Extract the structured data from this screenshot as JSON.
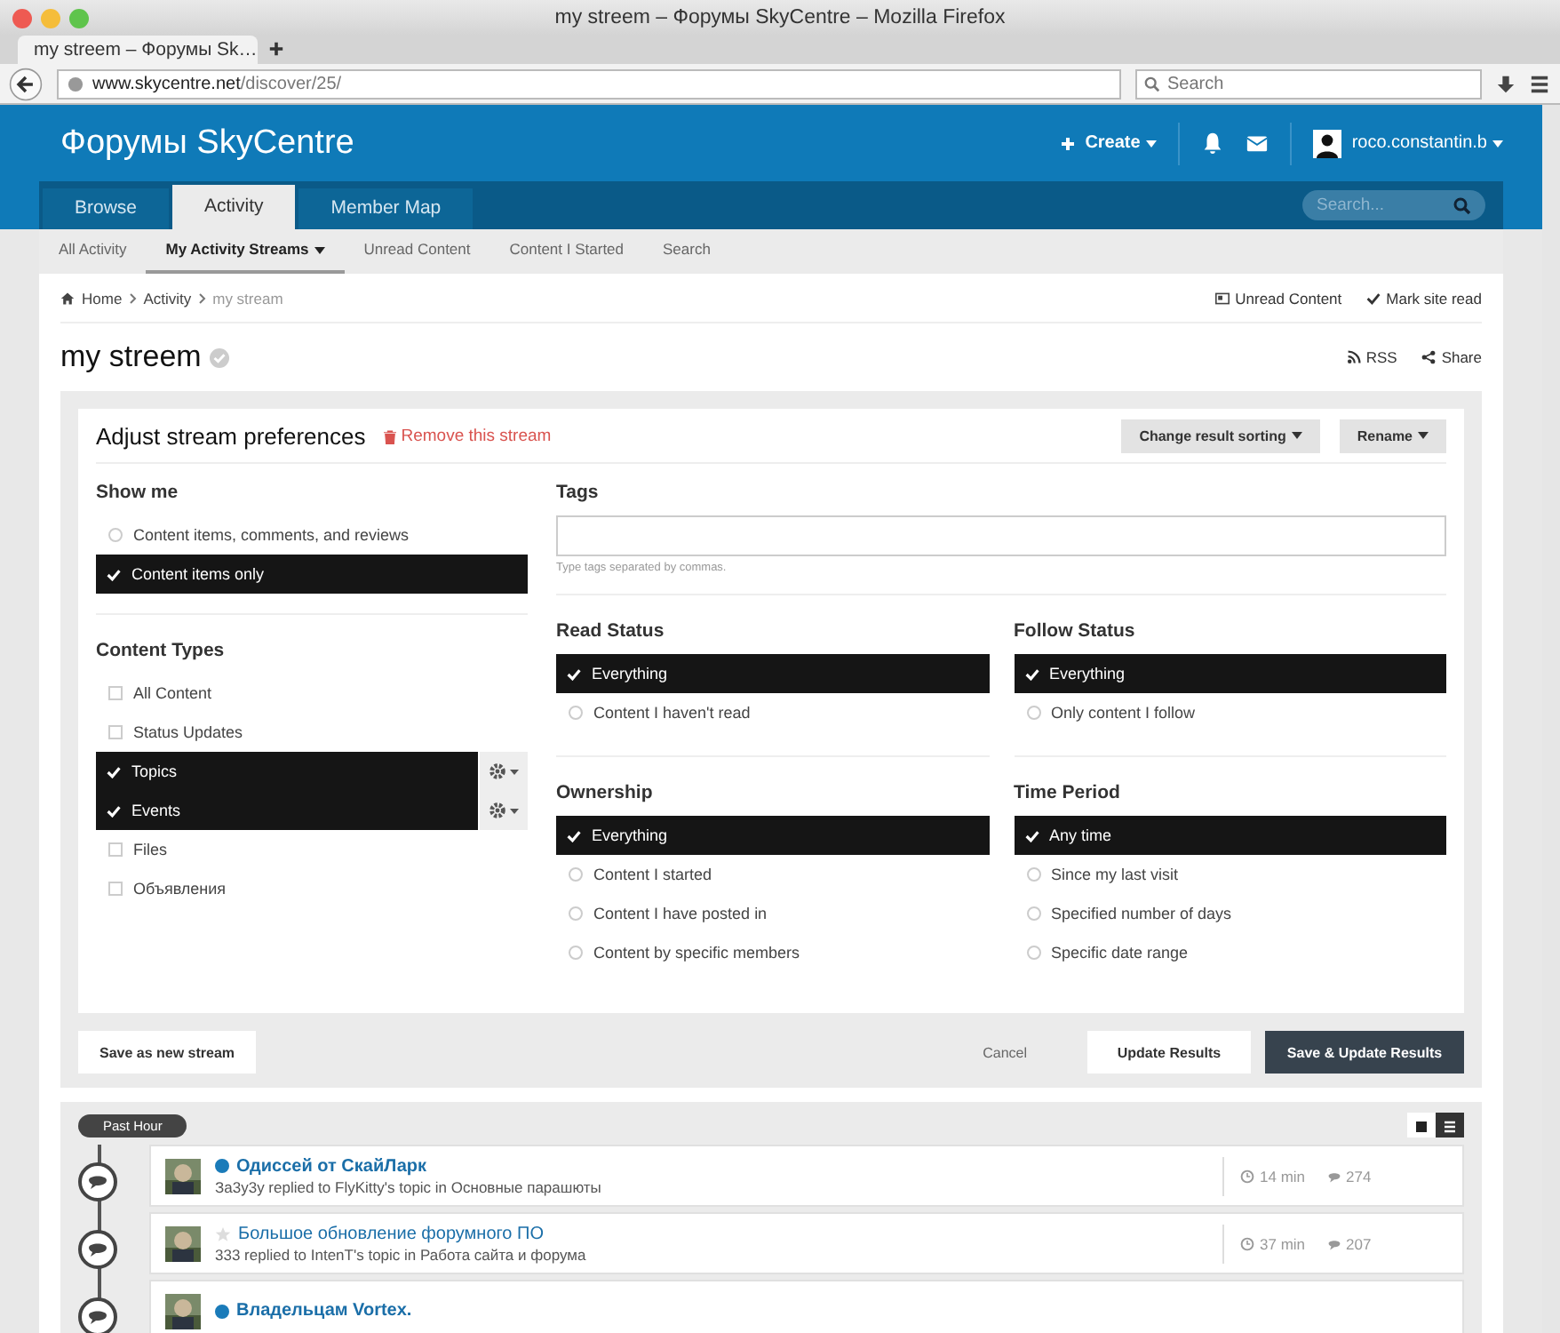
{
  "browser": {
    "title": "my streem – Форумы SkyCentre – Mozilla Firefox",
    "tab_title": "my streem – Форумы Sk…",
    "url_host": "www.skycentre.net",
    "url_path": "/discover/25/",
    "search_placeholder": "Search"
  },
  "site": {
    "name": "Форумы SkyCentre",
    "create": "Create",
    "user": "roco.constantin.b"
  },
  "nav_tabs": [
    {
      "label": "Browse",
      "selected": false
    },
    {
      "label": "Activity",
      "selected": true
    },
    {
      "label": "Member Map",
      "selected": false
    }
  ],
  "site_search_placeholder": "Search...",
  "subnav": [
    {
      "label": "All Activity",
      "selected": false,
      "has_menu": false
    },
    {
      "label": "My Activity Streams",
      "selected": true,
      "has_menu": true
    },
    {
      "label": "Unread Content",
      "selected": false,
      "has_menu": false
    },
    {
      "label": "Content I Started",
      "selected": false,
      "has_menu": false
    },
    {
      "label": "Search",
      "selected": false,
      "has_menu": false
    }
  ],
  "breadcrumb": [
    "Home",
    "Activity",
    "my stream"
  ],
  "page_actions": [
    {
      "kind": "unread",
      "label": "Unread Content"
    },
    {
      "kind": "mark",
      "label": "Mark site read"
    }
  ],
  "page_title": "my streem",
  "feed_links": [
    {
      "kind": "rss",
      "label": "RSS"
    },
    {
      "kind": "share",
      "label": "Share"
    }
  ],
  "prefs": {
    "title": "Adjust stream preferences",
    "remove": "Remove this stream",
    "sort_button": "Change result sorting",
    "rename_button": "Rename",
    "show_me": {
      "heading": "Show me",
      "options": [
        {
          "label": "Content items, comments, and reviews",
          "selected": false
        },
        {
          "label": "Content items only",
          "selected": true
        }
      ]
    },
    "content_types": {
      "heading": "Content Types",
      "items": [
        {
          "label": "All Content",
          "checked": false,
          "has_settings": false
        },
        {
          "label": "Status Updates",
          "checked": false,
          "has_settings": false
        },
        {
          "label": "Topics",
          "checked": true,
          "has_settings": true
        },
        {
          "label": "Events",
          "checked": true,
          "has_settings": true
        },
        {
          "label": "Files",
          "checked": false,
          "has_settings": false
        },
        {
          "label": "Объявления",
          "checked": false,
          "has_settings": false
        }
      ]
    },
    "tags": {
      "heading": "Tags",
      "hint": "Type tags separated by commas."
    },
    "filters": [
      {
        "heading": "Read Status",
        "options": [
          {
            "label": "Everything",
            "selected": true
          },
          {
            "label": "Content I haven't read",
            "selected": false
          }
        ]
      },
      {
        "heading": "Follow Status",
        "options": [
          {
            "label": "Everything",
            "selected": true
          },
          {
            "label": "Only content I follow",
            "selected": false
          }
        ]
      },
      {
        "heading": "Ownership",
        "options": [
          {
            "label": "Everything",
            "selected": true
          },
          {
            "label": "Content I started",
            "selected": false
          },
          {
            "label": "Content I have posted in",
            "selected": false
          },
          {
            "label": "Content by specific members",
            "selected": false
          }
        ]
      },
      {
        "heading": "Time Period",
        "options": [
          {
            "label": "Any time",
            "selected": true
          },
          {
            "label": "Since my last visit",
            "selected": false
          },
          {
            "label": "Specified number of days",
            "selected": false
          },
          {
            "label": "Specific date range",
            "selected": false
          }
        ]
      }
    ]
  },
  "actions": {
    "save_new": "Save as new stream",
    "cancel": "Cancel",
    "update": "Update Results",
    "save_update": "Save & Update Results"
  },
  "stream": {
    "period": "Past Hour",
    "view_modes": [
      {
        "kind": "condensed",
        "selected": false
      },
      {
        "kind": "expanded",
        "selected": true
      }
    ],
    "items": [
      {
        "title": "Одиссей от СкайЛарк",
        "unread": true,
        "summary": "За3у3у replied to FlyKitty's topic in Основные парашюты",
        "time": "14 min",
        "comments": "274"
      },
      {
        "title": "Большое обновление форумного ПО",
        "unread": false,
        "summary": "333 replied to IntenT's topic in Работа сайта и форума",
        "time": "37 min",
        "comments": "207"
      },
      {
        "title": "Владельцам Vortex.",
        "unread": true
      }
    ]
  }
}
